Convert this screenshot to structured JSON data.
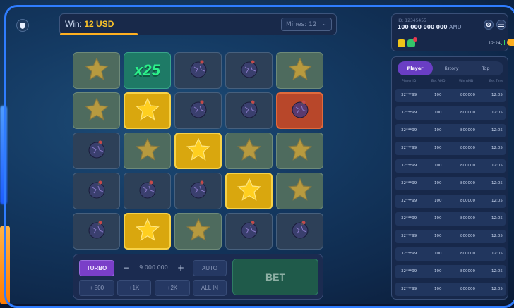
{
  "header": {
    "win_label": "Win:",
    "win_value": "12 USD",
    "mines_placeholder": "Mines: 12",
    "win_progress": 0.28
  },
  "grid": {
    "rows": [
      [
        {
          "type": "star",
          "state": "dim"
        },
        {
          "type": "multiplier",
          "label": "x25"
        },
        {
          "type": "bomb",
          "state": "normal"
        },
        {
          "type": "bomb",
          "state": "normal"
        },
        {
          "type": "star",
          "state": "dim"
        }
      ],
      [
        {
          "type": "star",
          "state": "dim"
        },
        {
          "type": "star",
          "state": "gold"
        },
        {
          "type": "bomb",
          "state": "normal"
        },
        {
          "type": "bomb",
          "state": "normal"
        },
        {
          "type": "bomb",
          "state": "hit"
        }
      ],
      [
        {
          "type": "bomb",
          "state": "normal"
        },
        {
          "type": "star",
          "state": "dim"
        },
        {
          "type": "star",
          "state": "gold"
        },
        {
          "type": "star",
          "state": "dim"
        },
        {
          "type": "star",
          "state": "dim"
        }
      ],
      [
        {
          "type": "bomb",
          "state": "normal"
        },
        {
          "type": "bomb",
          "state": "normal"
        },
        {
          "type": "bomb",
          "state": "normal"
        },
        {
          "type": "star",
          "state": "gold"
        },
        {
          "type": "star",
          "state": "dim"
        }
      ],
      [
        {
          "type": "bomb",
          "state": "normal"
        },
        {
          "type": "star",
          "state": "gold"
        },
        {
          "type": "star",
          "state": "dim"
        },
        {
          "type": "bomb",
          "state": "normal"
        },
        {
          "type": "bomb",
          "state": "normal"
        }
      ]
    ]
  },
  "controls": {
    "turbo_label": "TURBO",
    "minus_label": "−",
    "plus_label": "+",
    "amount": "9 000 000",
    "auto_label": "AUTO",
    "quick_500": "+ 500",
    "quick_1k": "+1K",
    "quick_2k": "+2K",
    "all_in_label": "ALL IN",
    "bet_label": "BET"
  },
  "account": {
    "id_text": "ID: 12345455",
    "balance": "100 000 000 000",
    "currency": "AMD",
    "time": "12:24"
  },
  "bets": {
    "tabs": [
      "Player",
      "History",
      "Top"
    ],
    "active_tab": "Player",
    "columns": [
      "Player ID",
      "Bet AMD",
      "Win AMD",
      "Bet Time"
    ],
    "rows": [
      [
        "32***99",
        "100",
        "800000",
        "12:05"
      ],
      [
        "32***99",
        "100",
        "800000",
        "12:05"
      ],
      [
        "32***99",
        "100",
        "800000",
        "12:05"
      ],
      [
        "32***99",
        "100",
        "800000",
        "12:05"
      ],
      [
        "32***99",
        "100",
        "800000",
        "12:05"
      ],
      [
        "32***99",
        "100",
        "800000",
        "12:05"
      ],
      [
        "32***99",
        "100",
        "800000",
        "12:05"
      ],
      [
        "32***99",
        "100",
        "800000",
        "12:05"
      ],
      [
        "32***99",
        "100",
        "800000",
        "12:05"
      ],
      [
        "32***99",
        "100",
        "800000",
        "12:05"
      ],
      [
        "32***99",
        "100",
        "800000",
        "12:05"
      ],
      [
        "32***99",
        "100",
        "800000",
        "12:05"
      ],
      [
        "32***99",
        "100",
        "800000",
        "12:05"
      ]
    ]
  },
  "colors": {
    "accent": "#2f7dff",
    "gold": "#ffc629",
    "turbo": "#7a3fc8",
    "bet": "#1f5a4a"
  }
}
